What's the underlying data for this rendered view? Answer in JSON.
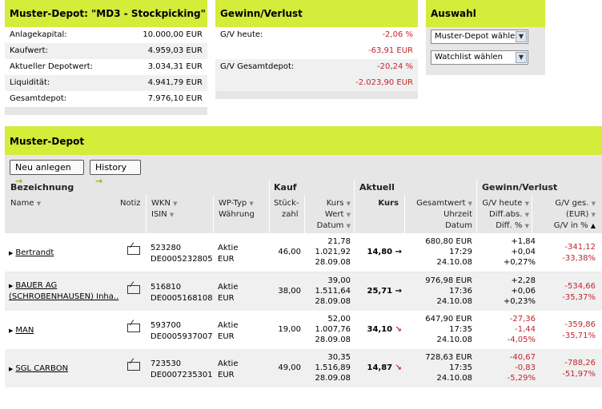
{
  "depot_box": {
    "title": "Muster-Depot: \"MD3 - Stockpicking\"",
    "rows": [
      {
        "label": "Anlagekapital:",
        "value": "10.000,00 EUR"
      },
      {
        "label": "Kaufwert:",
        "value": "4.959,03 EUR"
      },
      {
        "label": "Aktueller Depotwert:",
        "value": "3.034,31 EUR"
      },
      {
        "label": "Liquidität:",
        "value": "4.941,79 EUR"
      },
      {
        "label": "Gesamtdepot:",
        "value": "7.976,10 EUR"
      }
    ]
  },
  "gv_box": {
    "title": "Gewinn/Verlust",
    "today_label": "G/V heute:",
    "today_pct": "-2,06 %",
    "today_abs": "-63,91 EUR",
    "total_label": "G/V Gesamtdepot:",
    "total_pct": "-20,24 %",
    "total_abs": "-2.023,90 EUR"
  },
  "auswahl_box": {
    "title": "Auswahl",
    "select1": "Muster-Depot wählen",
    "select2": "Watchlist wählen"
  },
  "main": {
    "title": "Muster-Depot",
    "btn_new": "Neu anlegen",
    "btn_history": "History",
    "groups": {
      "bezeichnung": "Bezeichnung",
      "kauf": "Kauf",
      "aktuell": "Aktuell",
      "gv": "Gewinn/Verlust"
    },
    "cols": {
      "name": "Name",
      "notiz": "Notiz",
      "wkn": "WKN",
      "isin": "ISIN",
      "wptyp": "WP-Typ",
      "waehrung": "Währung",
      "stueck1": "Stück-",
      "stueck2": "zahl",
      "kurs": "Kurs",
      "wert": "Wert",
      "datum": "Datum",
      "akurs": "Kurs",
      "gesamtwert": "Gesamtwert",
      "uhrzeit": "Uhrzeit",
      "adatum": "Datum",
      "gvheute": "G/V heute",
      "diffabs": "Diff.abs.",
      "diffpct": "Diff. %",
      "gvges": "G/V ges.",
      "eur": "(EUR)",
      "gvinpct": "G/V in %"
    },
    "rows": [
      {
        "name": "Bertrandt",
        "name2": "",
        "wkn": "523280",
        "isin": "DE0005232805",
        "typ": "Aktie",
        "cur": "EUR",
        "stueck": "46,00",
        "kurs": "21,78",
        "wert": "1.021,92",
        "datum": "28.09.08",
        "akurs": "14,80",
        "dir": "→",
        "gesamt": "680,80 EUR",
        "zeit": "17:29",
        "adatum": "24.10.08",
        "gvh": "+1,84",
        "dabs": "+0,04",
        "dpct": "+0,27%",
        "gvg": "-341,12",
        "gvp": "-33,38%"
      },
      {
        "name": "BAUER AG",
        "name2": "(SCHROBENHAUSEN) Inha..",
        "wkn": "516810",
        "isin": "DE0005168108",
        "typ": "Aktie",
        "cur": "EUR",
        "stueck": "38,00",
        "kurs": "39,00",
        "wert": "1.511,64",
        "datum": "28.09.08",
        "akurs": "25,71",
        "dir": "→",
        "gesamt": "976,98 EUR",
        "zeit": "17:36",
        "adatum": "24.10.08",
        "gvh": "+2,28",
        "dabs": "+0,06",
        "dpct": "+0,23%",
        "gvg": "-534,66",
        "gvp": "-35,37%"
      },
      {
        "name": "MAN",
        "name2": "",
        "wkn": "593700",
        "isin": "DE0005937007",
        "typ": "Aktie",
        "cur": "EUR",
        "stueck": "19,00",
        "kurs": "52,00",
        "wert": "1.007,76",
        "datum": "28.09.08",
        "akurs": "34,10",
        "dir": "↘",
        "gesamt": "647,90 EUR",
        "zeit": "17:35",
        "adatum": "24.10.08",
        "gvh": "-27,36",
        "dabs": "-1,44",
        "dpct": "-4,05%",
        "gvg": "-359,86",
        "gvp": "-35,71%"
      },
      {
        "name": "SGL CARBON",
        "name2": "",
        "wkn": "723530",
        "isin": "DE0007235301",
        "typ": "Aktie",
        "cur": "EUR",
        "stueck": "49,00",
        "kurs": "30,35",
        "wert": "1.516,89",
        "datum": "28.09.08",
        "akurs": "14,87",
        "dir": "↘",
        "gesamt": "728,63 EUR",
        "zeit": "17:35",
        "adatum": "24.10.08",
        "gvh": "-40,67",
        "dabs": "-0,83",
        "dpct": "-5,29%",
        "gvg": "-788,26",
        "gvp": "-51,97%"
      }
    ]
  }
}
